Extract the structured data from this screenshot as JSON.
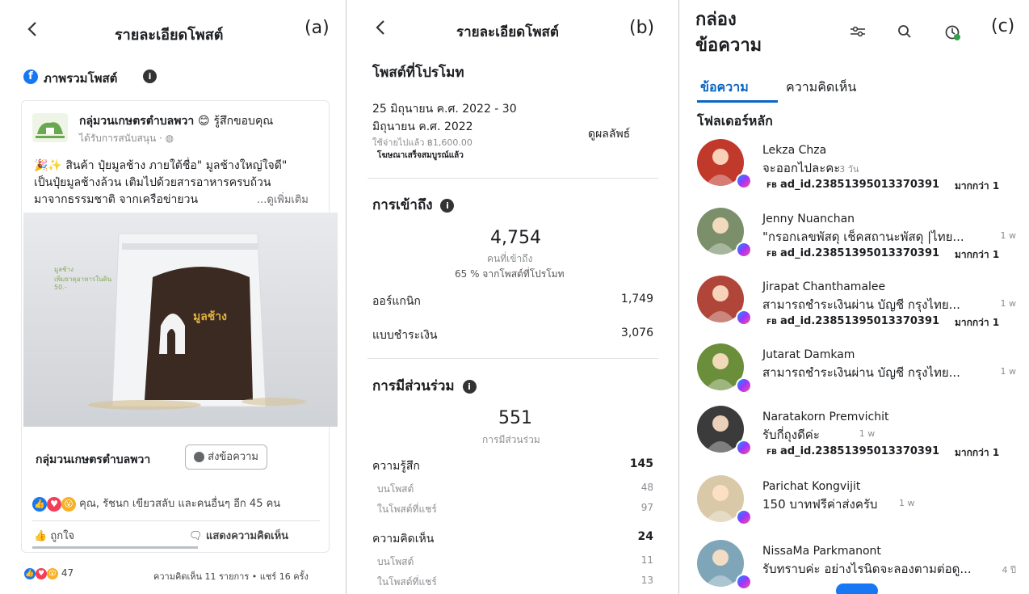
{
  "panel_a": {
    "label": "(a)",
    "header_title": "รายละเอียดโพสต์",
    "overview_title": "ภาพรวมโพสต์",
    "page_name": "กลุ่มวนเกษตรตำบลพวา",
    "feeling": "รู้สึกขอบคุณ",
    "sponsored": "ได้รับการสนับสนุน · ",
    "post_text_1": "สินค้า ปุ๋ยมูลช้าง ภายใต้ชื่อ\" มูลช้างใหญ่ใจดี\"",
    "post_text_2": "เป็นปุ๋ยมูลช้างล้วน เติมไปด้วยสารอาหารครบถ้วน",
    "post_text_3": "มาจากธรรมชาติ จากเครือข่ายวน",
    "see_more": "...ดูเพิ่มเติม",
    "bag_label_1": "มูลช้าง",
    "bag_label_2": "เพิ่มธาตุอาหารในดิน",
    "bag_label_3": "50.-",
    "bag_brand": "มูลช้าง",
    "cta_page": "กลุ่มวนเกษตรตำบลพวา",
    "cta_button": "ส่งข้อความ",
    "reactions_text": "คุณ, รัชนก เขียวสลับ และคนอื่นๆ อีก 45 คน",
    "like_label": "ถูกใจ",
    "comment_label": "แสดงความคิดเห็น",
    "reaction_count": "47",
    "footer_stats": "ความคิดเห็น 11 รายการ • แชร์ 16 ครั้ง"
  },
  "panel_b": {
    "label": "(b)",
    "header_title": "รายละเอียดโพสต์",
    "promoted_title": "โพสต์ที่โปรโมท",
    "date_line_1": "25 มิถุนายน ค.ศ. 2022 - 30",
    "date_line_2": "มิถุนายน ค.ศ. 2022",
    "spent": "ใช้จ่ายไปแล้ว ฿1,600.00",
    "status": "โฆษณาเสร็จสมบูรณ์แล้ว",
    "view_results": "ดูผลลัพธ์",
    "reach_title": "การเข้าถึง",
    "reach_value": "4,754",
    "reach_caption": "คนที่เข้าถึง",
    "reach_pct": "65 % จากโพสต์ที่โปรโมท",
    "organic_label": "ออร์แกนิก",
    "organic_value": "1,749",
    "paid_label": "แบบชำระเงิน",
    "paid_value": "3,076",
    "engagement_title": "การมีส่วนร่วม",
    "engagement_value": "551",
    "engagement_caption": "การมีส่วนร่วม",
    "reactions_label": "ความรู้สึก",
    "reactions_value": "145",
    "on_post_label": "บนโพสต์",
    "on_post_value": "48",
    "on_shares_label": "ในโพสต์ที่แชร์",
    "on_shares_value": "97",
    "comments_label": "ความคิดเห็น",
    "comments_value": "24",
    "c_on_post_label": "บนโพสต์",
    "c_on_post_value": "11",
    "c_on_shares_label": "ในโพสต์ที่แชร์",
    "c_on_shares_value": "13"
  },
  "panel_c": {
    "label": "(c)",
    "title_line_1": "กล่อง",
    "title_line_2": "ข้อความ",
    "tab_messages": "ข้อความ",
    "tab_comments": "ความคิดเห็น",
    "folder_title": "โฟลเดอร์หลัก",
    "conversations": [
      {
        "name": "Lekza Chza",
        "preview": "จะออกไปละคะ",
        "time": "3 วัน",
        "ad": "ad_id.23851395013370391",
        "more": "มากกว่า 1",
        "color": "#c0392b"
      },
      {
        "name": "Jenny Nuanchan",
        "preview": "\"กรอกเลขพัสดุ เช็คสถานะพัสดุ |ไทย...",
        "time": "1 w",
        "ad": "ad_id.23851395013370391",
        "more": "มากกว่า 1",
        "color": "#7a8f6a"
      },
      {
        "name": "Jirapat Chanthamalee",
        "preview": "สามารถชำระเงินผ่าน บัญชี กรุงไทย...",
        "time": "1 w",
        "ad": "ad_id.23851395013370391",
        "more": "มากกว่า 1",
        "color": "#b0463a"
      },
      {
        "name": "Jutarat Damkam",
        "preview": "สามารถชำระเงินผ่าน บัญชี กรุงไทย...",
        "time": "1 w",
        "ad": "",
        "more": "",
        "color": "#6b8e3a"
      },
      {
        "name": "Naratakorn Premvichit",
        "preview": "รับกี่ถุงดีค่ะ",
        "time": "1 w",
        "ad": "ad_id.23851395013370391",
        "more": "มากกว่า 1",
        "color": "#3b3b3b"
      },
      {
        "name": "Parichat Kongvijit",
        "preview": "150 บาทฟรีค่าส่งครับ",
        "time": "1 w",
        "ad": "",
        "more": "",
        "color": "#d9c9a8"
      },
      {
        "name": "NissaMa Parkmanont",
        "preview": "รับทราบค่ะ อย่างไรนิดจะลองตามต่อดู...",
        "time": "4 ปี",
        "ad": "",
        "more": "",
        "color": "#7fa6b8"
      }
    ],
    "ad_prefix": "FB"
  }
}
